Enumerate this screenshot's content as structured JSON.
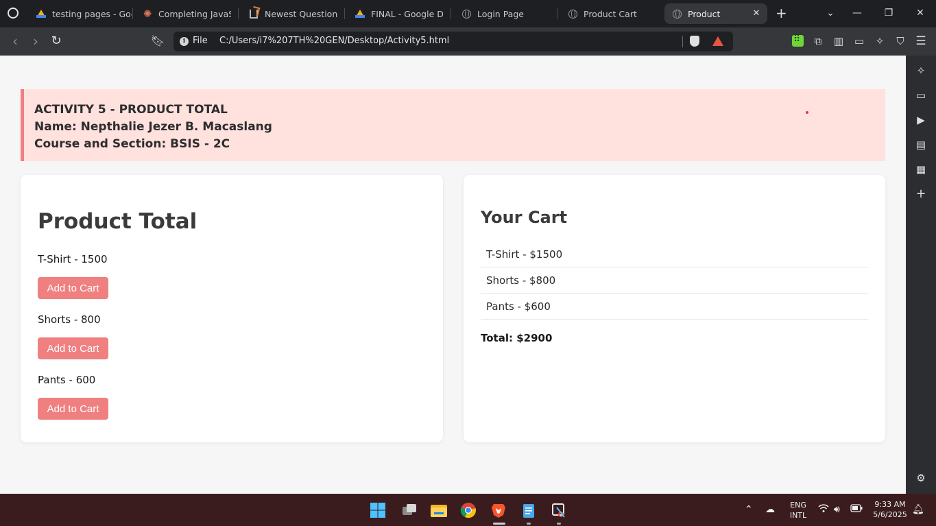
{
  "browser": {
    "tabs": [
      {
        "label": "testing pages - Goo",
        "icon": "google-drive-icon",
        "active": false
      },
      {
        "label": "Completing JavaScr",
        "icon": "claude-icon",
        "active": false
      },
      {
        "label": "Newest Questions -",
        "icon": "stackoverflow-icon",
        "active": false
      },
      {
        "label": "FINAL - Google Driv",
        "icon": "google-drive-icon",
        "active": false
      },
      {
        "label": "Login Page",
        "icon": "globe-icon",
        "active": false
      },
      {
        "label": "Product Cart",
        "icon": "globe-icon",
        "active": false
      },
      {
        "label": "Product",
        "icon": "globe-icon",
        "active": true
      }
    ],
    "address": {
      "scheme_label": "File",
      "url": "C:/Users/i7%207TH%20GEN/Desktop/Activity5.html"
    }
  },
  "header": {
    "line1": "ACTIVITY 5 - PRODUCT TOTAL",
    "line2": "Name: Nepthalie Jezer B. Macaslang",
    "line3": "Course and Section: BSIS - 2C"
  },
  "products": {
    "title": "Product Total",
    "items": [
      {
        "label": "T-Shirt - 1500",
        "button": "Add to Cart"
      },
      {
        "label": "Shorts - 800",
        "button": "Add to Cart"
      },
      {
        "label": "Pants - 600",
        "button": "Add to Cart"
      }
    ]
  },
  "cart": {
    "title": "Your Cart",
    "items": [
      "T-Shirt - $1500",
      "Shorts - $800",
      "Pants - $600"
    ],
    "total": "Total: $2900"
  },
  "taskbar": {
    "lang_top": "ENG",
    "lang_bottom": "INTL",
    "time": "9:33 AM",
    "date": "5/6/2025"
  },
  "colors": {
    "accent": "#f08080",
    "header_bg": "#ffe1de",
    "header_border": "#f07f84"
  }
}
